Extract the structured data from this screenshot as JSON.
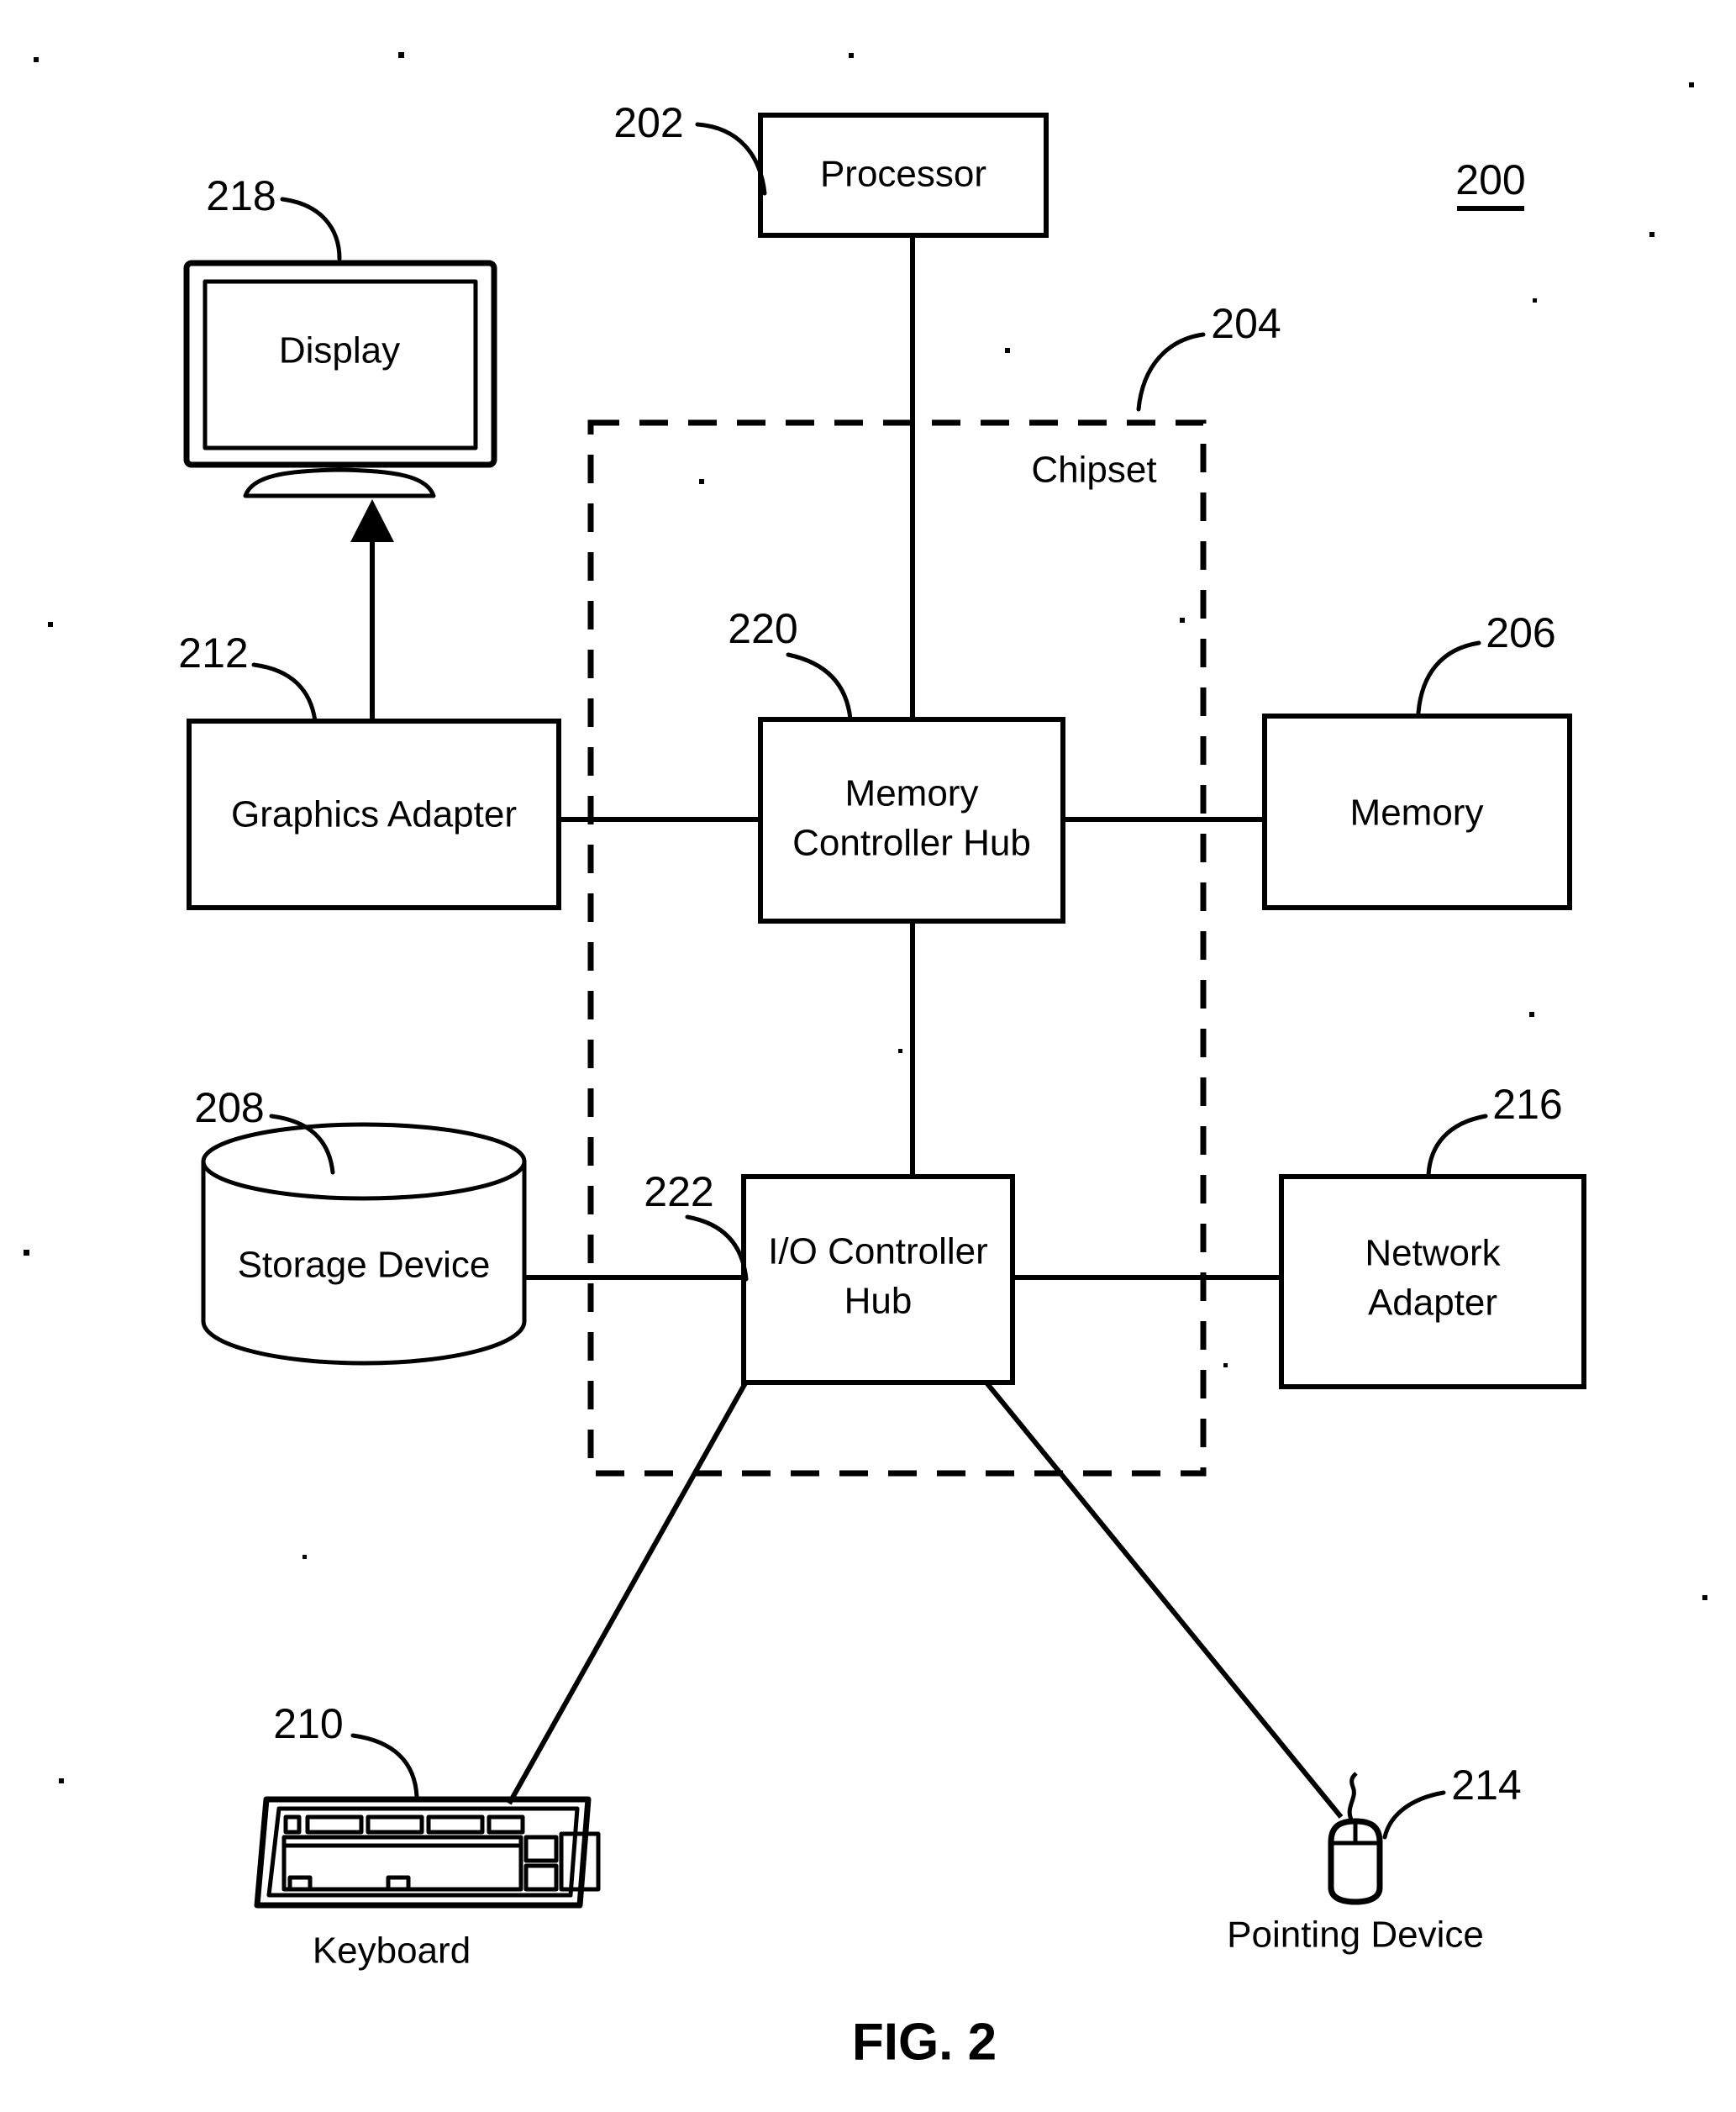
{
  "figure": {
    "caption": "FIG. 2",
    "figure_ref": "200"
  },
  "blocks": [
    {
      "key": "processor",
      "label": "Processor",
      "ref": "202"
    },
    {
      "key": "chipset",
      "label": "Chipset",
      "ref": "204"
    },
    {
      "key": "memory",
      "label": "Memory",
      "ref": "206"
    },
    {
      "key": "storage_device",
      "label": "Storage Device",
      "ref": "208"
    },
    {
      "key": "keyboard",
      "label": "Keyboard",
      "ref": "210"
    },
    {
      "key": "graphics_adapter",
      "label": "Graphics Adapter",
      "ref": "212"
    },
    {
      "key": "pointing_device",
      "label": "Pointing Device",
      "ref": "214"
    },
    {
      "key": "network_adapter",
      "label": "Network Adapter",
      "ref": "216"
    },
    {
      "key": "display",
      "label": "Display",
      "ref": "218"
    },
    {
      "key": "memory_controller_hub",
      "label": "Memory Controller Hub",
      "ref": "220"
    },
    {
      "key": "io_controller_hub",
      "label": "I/O Controller Hub",
      "ref": "222"
    }
  ],
  "labels": {
    "processor": "Processor",
    "chipset": "Chipset",
    "memory": "Memory",
    "storage_device": "Storage Device",
    "keyboard": "Keyboard",
    "graphics_adapter": "Graphics Adapter",
    "pointing_device": "Pointing Device",
    "network_adapter_line1": "Network",
    "network_adapter_line2": "Adapter",
    "display": "Display",
    "memory_controller_hub_line1": "Memory",
    "memory_controller_hub_line2": "Controller Hub",
    "io_controller_hub_line1": "I/O Controller",
    "io_controller_hub_line2": "Hub"
  },
  "refs": {
    "processor": "202",
    "chipset": "204",
    "memory": "206",
    "storage_device": "208",
    "keyboard": "210",
    "graphics_adapter": "212",
    "pointing_device": "214",
    "network_adapter": "216",
    "display": "218",
    "memory_controller_hub": "220",
    "io_controller_hub": "222",
    "figure": "200"
  },
  "colors": {
    "ink": "#000000",
    "paper": "#ffffff"
  },
  "connections": [
    {
      "from": "processor",
      "to": "memory_controller_hub",
      "style": "solid"
    },
    {
      "from": "graphics_adapter",
      "to": "memory_controller_hub",
      "style": "solid"
    },
    {
      "from": "graphics_adapter",
      "to": "display",
      "style": "arrow"
    },
    {
      "from": "memory_controller_hub",
      "to": "memory",
      "style": "solid"
    },
    {
      "from": "memory_controller_hub",
      "to": "io_controller_hub",
      "style": "solid"
    },
    {
      "from": "storage_device",
      "to": "io_controller_hub",
      "style": "solid"
    },
    {
      "from": "io_controller_hub",
      "to": "network_adapter",
      "style": "solid"
    },
    {
      "from": "io_controller_hub",
      "to": "keyboard",
      "style": "solid"
    },
    {
      "from": "io_controller_hub",
      "to": "pointing_device",
      "style": "solid"
    }
  ]
}
